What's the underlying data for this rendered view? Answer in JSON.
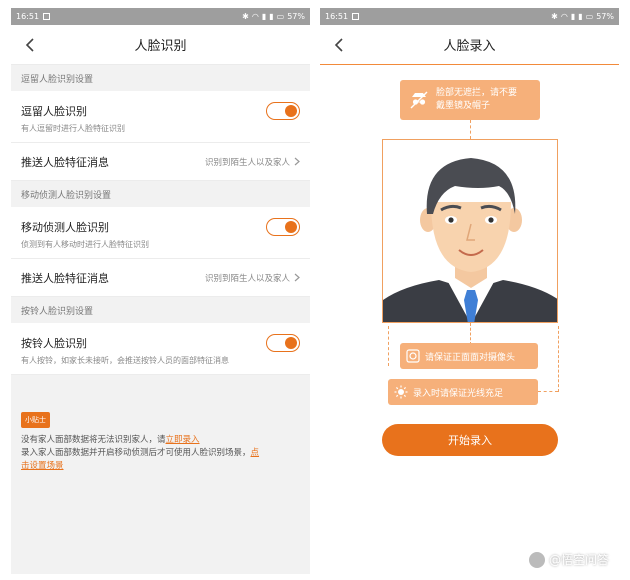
{
  "left": {
    "status": {
      "time": "16:51",
      "battery": "57%"
    },
    "title": "人脸识别",
    "sections": [
      {
        "header": "逗留人脸识别设置",
        "toggle": {
          "title": "逗留人脸识别",
          "sub": "有人逗留时进行人脸特征识别",
          "on": true
        },
        "link": {
          "title": "推送人脸特征消息",
          "value": "识别到陌生人以及家人"
        }
      },
      {
        "header": "移动侦测人脸识别设置",
        "toggle": {
          "title": "移动侦测人脸识别",
          "sub": "侦测到有人移动时进行人脸特征识别",
          "on": true
        },
        "link": {
          "title": "推送人脸特征消息",
          "value": "识别到陌生人以及家人"
        }
      },
      {
        "header": "按铃人脸识别设置",
        "toggle": {
          "title": "按铃人脸识别",
          "sub": "有人按铃，如家长未接听，会推送按铃人员的面部特征消息",
          "on": true
        }
      }
    ],
    "tips": {
      "badge": "小贴士",
      "line1_prefix": "没有家人面部数据将无法识别家人，请",
      "line1_link": "立即录入",
      "line2_prefix": "录入家人面部数据并开启移动侦测后才可使用人脸识别场景，",
      "line2_link_a": "点",
      "line2_link_b": "击设置场景"
    }
  },
  "right": {
    "status": {
      "time": "16:51",
      "battery": "57%"
    },
    "title": "人脸录入",
    "hint_top_line1": "脸部无遮拦，请不要",
    "hint_top_line2": "戴墨镜及帽子",
    "hint_middle": "请保证正面面对摄像头",
    "hint_bottom": "录入时请保证光线充足",
    "start_button": "开始录入"
  },
  "watermark": "@悟空问答",
  "colors": {
    "accent": "#e8721c",
    "bubble": "#f6b07a"
  }
}
